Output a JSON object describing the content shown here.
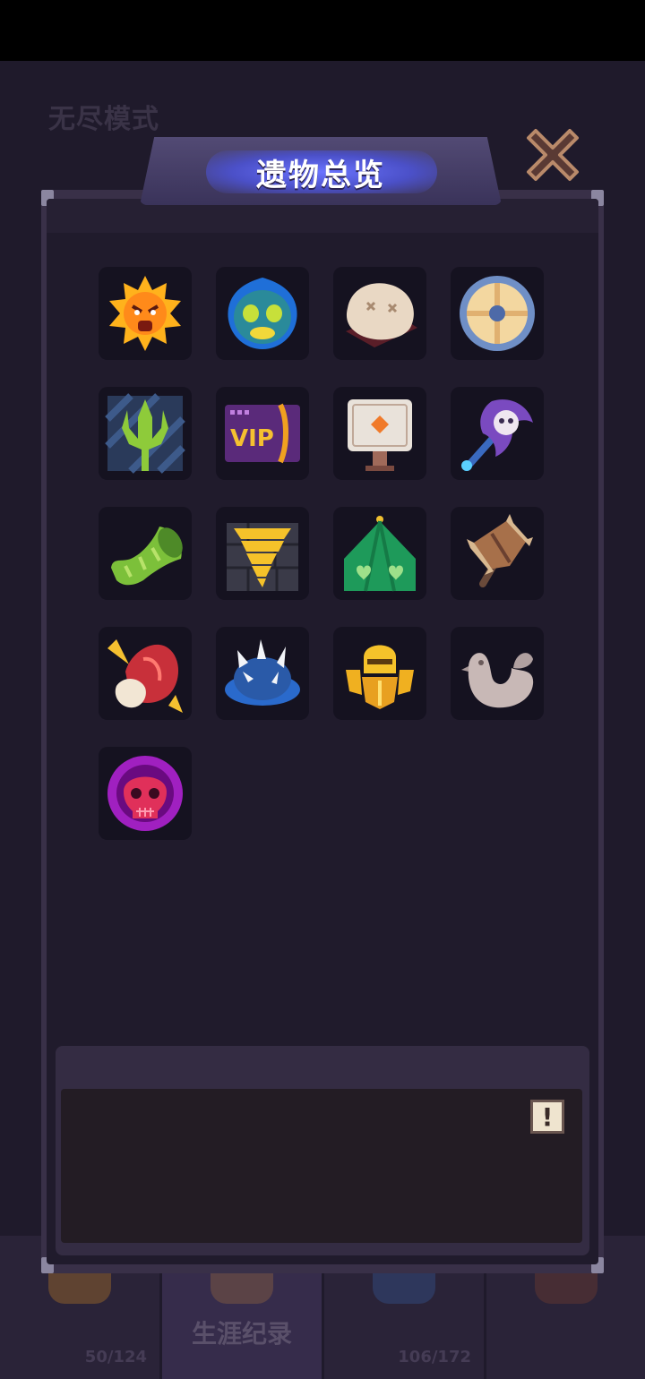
{
  "background": {
    "mode_title": "无尽模式",
    "tabs": [
      {
        "label": "",
        "count": "50/124"
      },
      {
        "label": "生涯纪录",
        "count": ""
      },
      {
        "label": "",
        "count": "106/172"
      },
      {
        "label": "",
        "count": ""
      }
    ]
  },
  "panel": {
    "title": "遗物总览",
    "close_icon": "close-x-icon",
    "info_icon_label": "!"
  },
  "relics": [
    {
      "icon": "angry-sun-icon"
    },
    {
      "icon": "blue-flame-mask-icon"
    },
    {
      "icon": "pillow-icon"
    },
    {
      "icon": "round-shield-icon"
    },
    {
      "icon": "green-trident-icon"
    },
    {
      "icon": "vip-card-icon",
      "text": "VIP"
    },
    {
      "icon": "stone-signpost-icon"
    },
    {
      "icon": "skull-axe-icon"
    },
    {
      "icon": "green-horn-icon"
    },
    {
      "icon": "tornado-icon"
    },
    {
      "icon": "green-tent-icon"
    },
    {
      "icon": "spiked-wooden-club-icon"
    },
    {
      "icon": "meat-chunk-icon"
    },
    {
      "icon": "spiked-blue-shell-icon"
    },
    {
      "icon": "golden-knight-icon"
    },
    {
      "icon": "stone-rooster-icon"
    },
    {
      "icon": "red-skull-icon"
    }
  ]
}
